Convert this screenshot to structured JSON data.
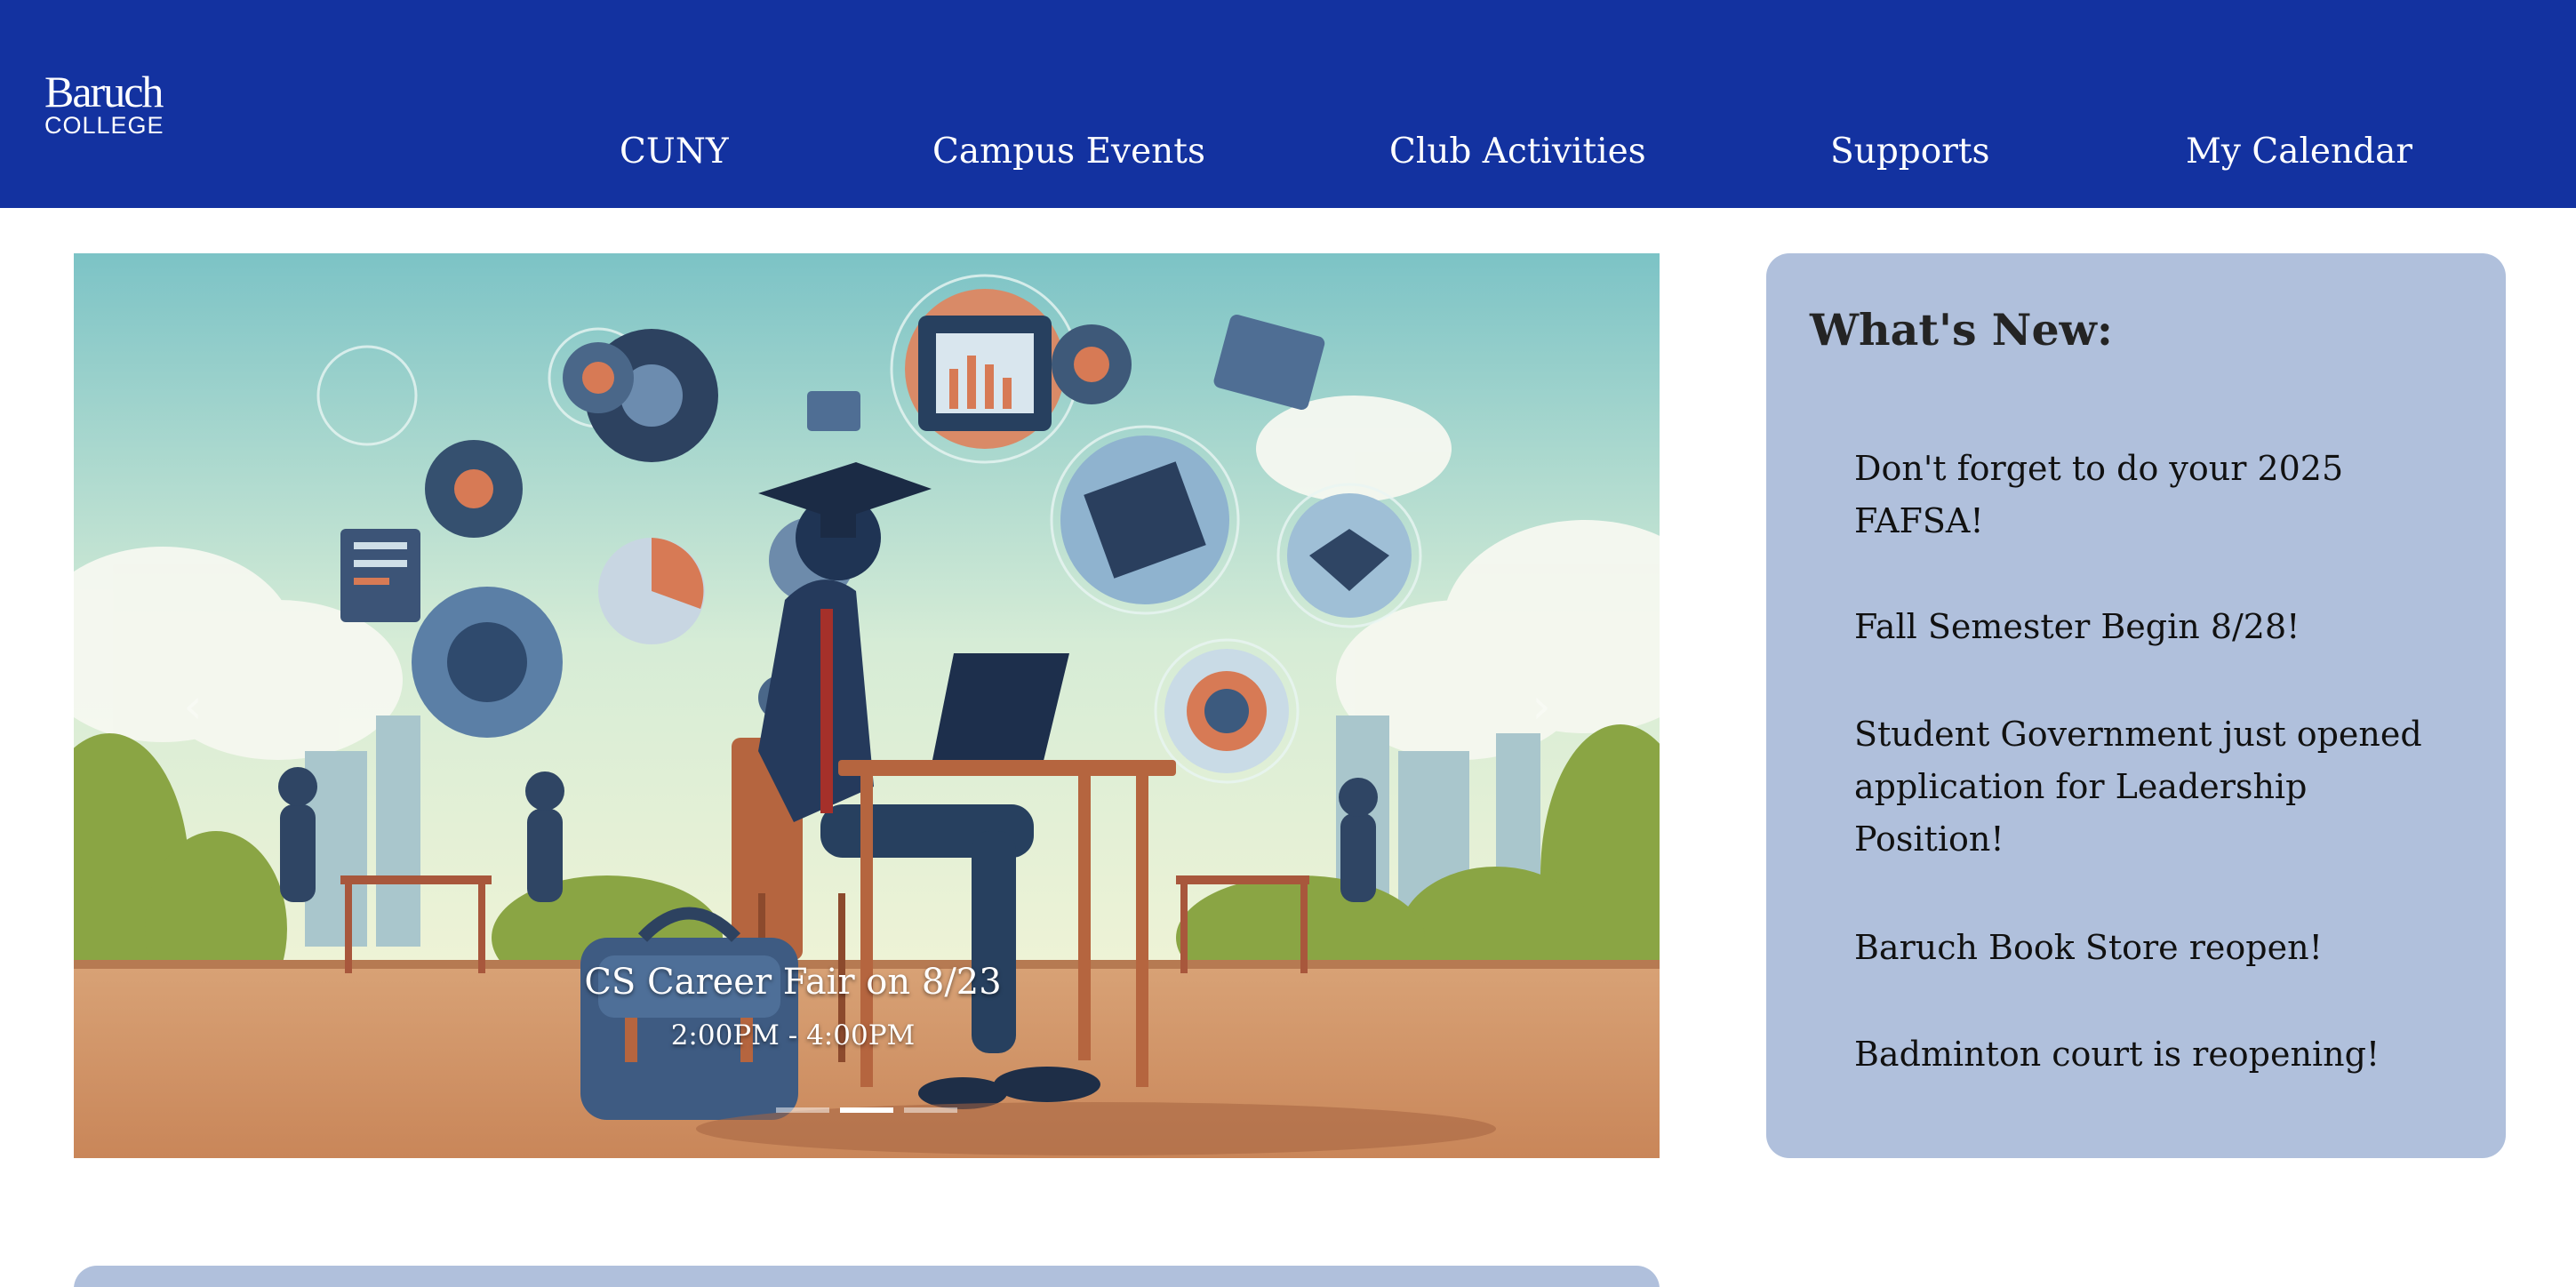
{
  "header": {
    "logo": {
      "line1": "Baruch",
      "line2": "COLLEGE"
    },
    "nav": [
      {
        "label": "CUNY"
      },
      {
        "label": "Campus Events"
      },
      {
        "label": "Club Activities"
      },
      {
        "label": "Supports"
      },
      {
        "label": "My Calendar"
      }
    ]
  },
  "carousel": {
    "caption_title": "CS Career Fair on 8/23",
    "caption_time": "2:00PM - 4:00PM",
    "slide_count": 3,
    "active_slide": 2,
    "prev_icon": "chevron-left-icon",
    "next_icon": "chevron-right-icon"
  },
  "news": {
    "title": "What's New:",
    "items": [
      "Don't forget to do your 2025 FAFSA!",
      "Fall Semester Begin 8/28!",
      "Student Government just opened application for Leadership Position!",
      "Baruch Book Store reopen!",
      "Badminton court is reopening!"
    ]
  },
  "colors": {
    "header_bg": "#1332a0",
    "panel_bg": "#b0c0dc",
    "text_dark": "#111111"
  }
}
